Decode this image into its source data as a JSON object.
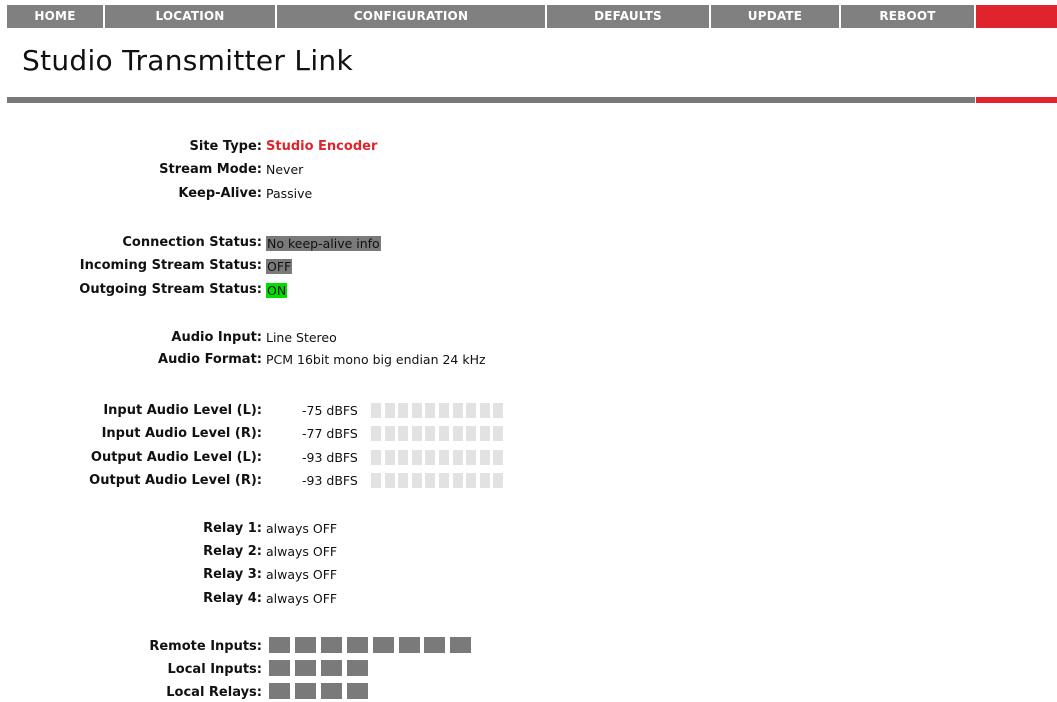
{
  "nav": {
    "items": [
      "HOME",
      "LOCATION",
      "CONFIGURATION",
      "DEFAULTS",
      "UPDATE",
      "REBOOT"
    ]
  },
  "page": {
    "title": "Studio Transmitter Link"
  },
  "site": {
    "site_type_label": "Site Type:",
    "site_type": "Studio Encoder",
    "stream_mode_label": "Stream Mode:",
    "stream_mode": "Never",
    "keep_alive_label": "Keep-Alive:",
    "keep_alive": "Passive"
  },
  "status": {
    "connection_label": "Connection Status:",
    "connection": "No keep-alive info",
    "incoming_label": "Incoming Stream Status:",
    "incoming": "OFF",
    "outgoing_label": "Outgoing Stream Status:",
    "outgoing": "ON"
  },
  "audio": {
    "input_label": "Audio Input:",
    "input": "Line Stereo",
    "format_label": "Audio Format:",
    "format": "PCM 16bit mono big endian 24 kHz"
  },
  "levels": [
    {
      "label": "Input Audio Level (L):",
      "value": "-75 dBFS",
      "lit_segments": 0,
      "total_segments": 10
    },
    {
      "label": "Input Audio Level (R):",
      "value": "-77 dBFS",
      "lit_segments": 0,
      "total_segments": 10
    },
    {
      "label": "Output Audio Level (L):",
      "value": "-93 dBFS",
      "lit_segments": 0,
      "total_segments": 10
    },
    {
      "label": "Output Audio Level (R):",
      "value": "-93 dBFS",
      "lit_segments": 0,
      "total_segments": 10
    }
  ],
  "relays": [
    {
      "label": "Relay 1:",
      "value": "always OFF"
    },
    {
      "label": "Relay 2:",
      "value": "always OFF"
    },
    {
      "label": "Relay 3:",
      "value": "always OFF"
    },
    {
      "label": "Relay 4:",
      "value": "always OFF"
    }
  ],
  "io": {
    "remote_inputs_label": "Remote Inputs:",
    "remote_inputs_count": 8,
    "local_inputs_label": "Local Inputs:",
    "local_inputs_count": 4,
    "local_relays_label": "Local Relays:",
    "local_relays_count": 4
  },
  "colors": {
    "accent": "#e0242d",
    "nav_bg": "#808080",
    "status_off": "#7a7a7a",
    "status_on": "#00e000",
    "meter_off": "#e2e2e2",
    "block_off": "#7a7a7a"
  }
}
